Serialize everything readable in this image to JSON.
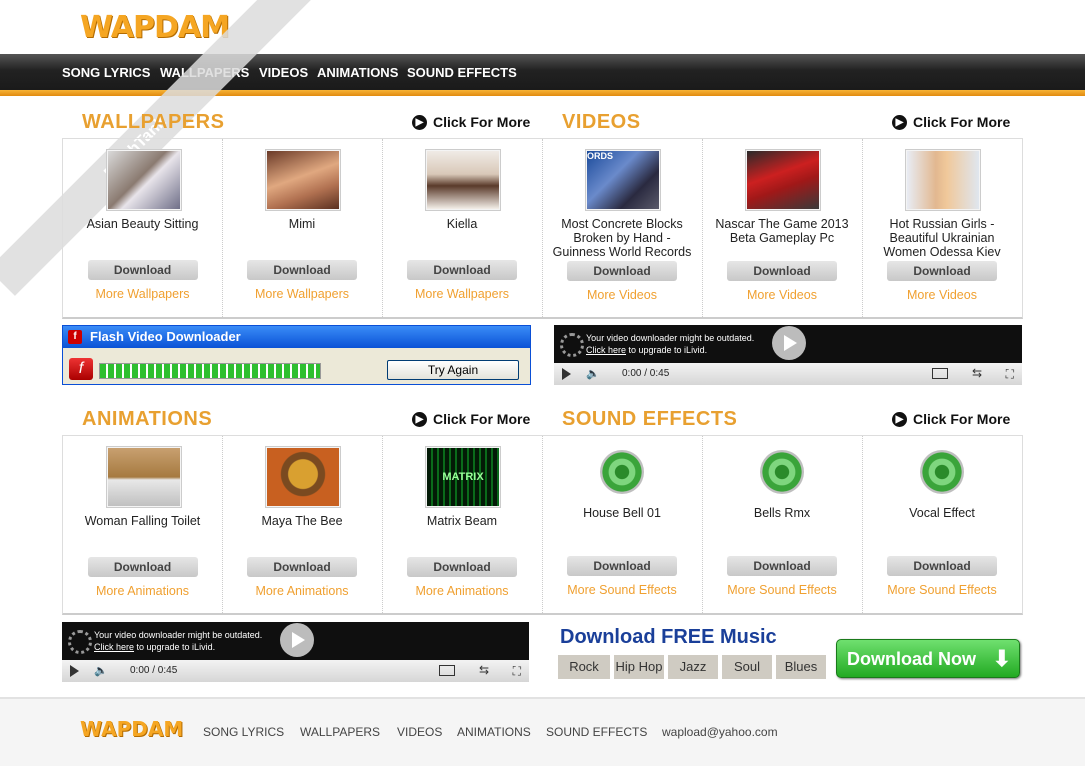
{
  "brand": {
    "logo": "WAPDAM"
  },
  "nav": [
    "SONG LYRICS",
    "WALLPAPERS",
    "VIDEOS",
    "ANIMATIONS",
    "SOUND EFFECTS"
  ],
  "sections": {
    "wallpapers": {
      "title": "WALLPAPERS",
      "more_link": "Click For More",
      "items": [
        {
          "title": "Asian Beauty Sitting",
          "button": "Download",
          "more": "More Wallpapers"
        },
        {
          "title": "Mimi",
          "button": "Download",
          "more": "More Wallpapers"
        },
        {
          "title": "Kiella",
          "button": "Download",
          "more": "More Wallpapers"
        }
      ]
    },
    "videos": {
      "title": "VIDEOS",
      "more_link": "Click For More",
      "items": [
        {
          "title": "Most Concrete Blocks Broken by Hand - Guinness World Records",
          "button": "Download",
          "more": "More Videos"
        },
        {
          "title": "Nascar The Game 2013 Beta Gameplay Pc",
          "button": "Download",
          "more": "More Videos"
        },
        {
          "title": "Hot Russian Girls - Beautiful Ukrainian Women Odessa Kiev",
          "button": "Download",
          "more": "More Videos"
        }
      ]
    },
    "animations": {
      "title": "ANIMATIONS",
      "more_link": "Click For More",
      "items": [
        {
          "title": "Woman Falling Toilet",
          "button": "Download",
          "more": "More Animations"
        },
        {
          "title": "Maya The Bee",
          "button": "Download",
          "more": "More Animations"
        },
        {
          "title": "Matrix Beam",
          "button": "Download",
          "more": "More Animations"
        }
      ]
    },
    "sound_effects": {
      "title": "SOUND EFFECTS",
      "more_link": "Click For More",
      "items": [
        {
          "title": "House Bell 01",
          "button": "Download",
          "more": "More Sound Effects"
        },
        {
          "title": "Bells Rmx",
          "button": "Download",
          "more": "More Sound Effects"
        },
        {
          "title": "Vocal Effect",
          "button": "Download",
          "more": "More Sound Effects"
        }
      ]
    }
  },
  "flash_ad": {
    "title": "Flash Video Downloader",
    "button": "Try Again"
  },
  "video_ad": {
    "line1": "Your video downloader might be outdated.",
    "link": "Click here",
    "line2": " to upgrade to iLivid.",
    "time": "0:00 / 0:45"
  },
  "thumb_text": {
    "video1": "ORDS",
    "anim3": "MATRIX"
  },
  "music": {
    "heading": "Download FREE Music",
    "genres": [
      "Rock",
      "Hip Hop",
      "Jazz",
      "Soul",
      "Blues"
    ],
    "download_button": "Download Now"
  },
  "watermark": "PhishTank",
  "footer": {
    "links": [
      "SONG LYRICS",
      "WALLPAPERS",
      "VIDEOS",
      "ANIMATIONS",
      "SOUND EFFECTS"
    ],
    "email": "wapload@yahoo.com"
  },
  "colors": {
    "accent": "#e8a030",
    "nav_bg": "#222222",
    "link": "#f0a030",
    "music_heading": "#1a3f99",
    "download_green": "#33bb33"
  }
}
